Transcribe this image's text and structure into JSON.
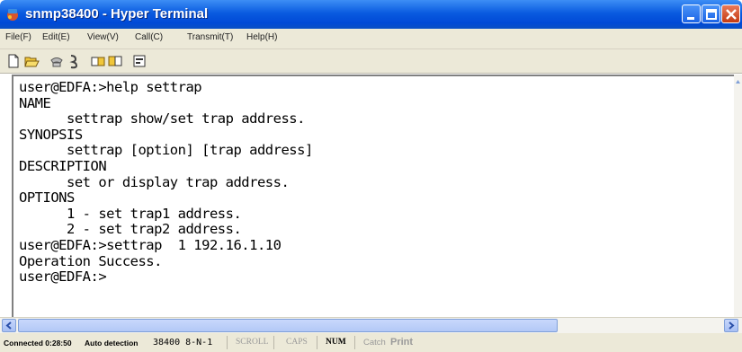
{
  "window": {
    "title": "snmp38400 - Hyper Terminal"
  },
  "menu": [
    "File(F)",
    "Edit(E)",
    "View(V)",
    "Call(C)",
    "Transmit(T)",
    "Help(H)"
  ],
  "toolbar": {
    "icons": [
      "new-icon",
      "open-icon",
      "phone-icon",
      "disconnect-icon",
      "send-icon",
      "receive-icon",
      "properties-icon"
    ]
  },
  "terminal": {
    "lines": [
      "user@EDFA:>help settrap",
      "NAME",
      "      settrap show/set trap address.",
      "SYNOPSIS",
      "      settrap [option] [trap address]",
      "DESCRIPTION",
      "      set or display trap address.",
      "OPTIONS",
      "      1 - set trap1 address.",
      "      2 - set trap2 address.",
      "user@EDFA:>settrap  1 192.16.1.10",
      "Operation Success.",
      "user@EDFA:>"
    ]
  },
  "status": {
    "connected": "Connected 0:28:50",
    "detection": "Auto detection",
    "baud": "38400 8-N-1",
    "scroll": "SCROLL",
    "caps": "CAPS",
    "num": "NUM",
    "capture": "Catch",
    "print": "Print"
  },
  "colors": {
    "title_bar": "#0a5be0",
    "chrome": "#ece9d8",
    "close_button": "#c43a12"
  }
}
